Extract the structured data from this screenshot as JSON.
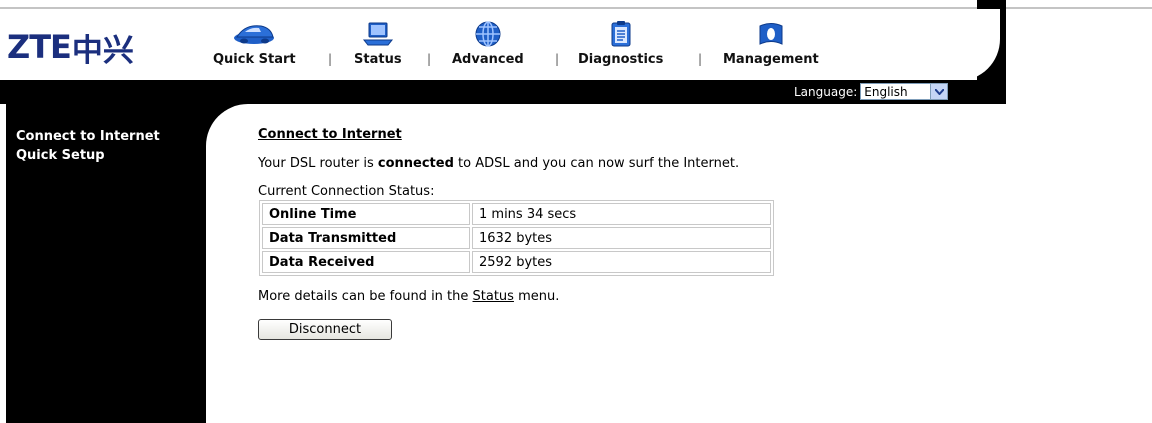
{
  "brand": {
    "logo_latin": "ZTE",
    "logo_cn": "中兴"
  },
  "nav": [
    {
      "label": "Quick Start",
      "icon": "car-icon"
    },
    {
      "label": "Status",
      "icon": "laptop-icon"
    },
    {
      "label": "Advanced",
      "icon": "globe-icon"
    },
    {
      "label": "Diagnostics",
      "icon": "clipboard-icon"
    },
    {
      "label": "Management",
      "icon": "book-icon"
    }
  ],
  "nav_separator": "|",
  "language": {
    "label": "Language:",
    "selected": "English"
  },
  "sidebar": [
    {
      "label": "Connect to Internet"
    },
    {
      "label": "Quick Setup"
    }
  ],
  "main": {
    "title": "Connect to Internet",
    "intro_before": "Your DSL router is ",
    "intro_bold": "connected",
    "intro_after": " to ADSL and you can now surf the Internet.",
    "status_caption": "Current Connection Status:",
    "rows": [
      {
        "key": "Online Time",
        "value": "1 mins 34 secs"
      },
      {
        "key": "Data Transmitted",
        "value": "1632 bytes"
      },
      {
        "key": "Data Received",
        "value": "2592 bytes"
      }
    ],
    "more_before": "More details can be found in the ",
    "more_link": "Status",
    "more_after": " menu.",
    "disconnect_label": "Disconnect"
  },
  "colors": {
    "brand_blue": "#1b2f7e",
    "frame": "#000000",
    "icon_blue": "#1f5fc7"
  }
}
